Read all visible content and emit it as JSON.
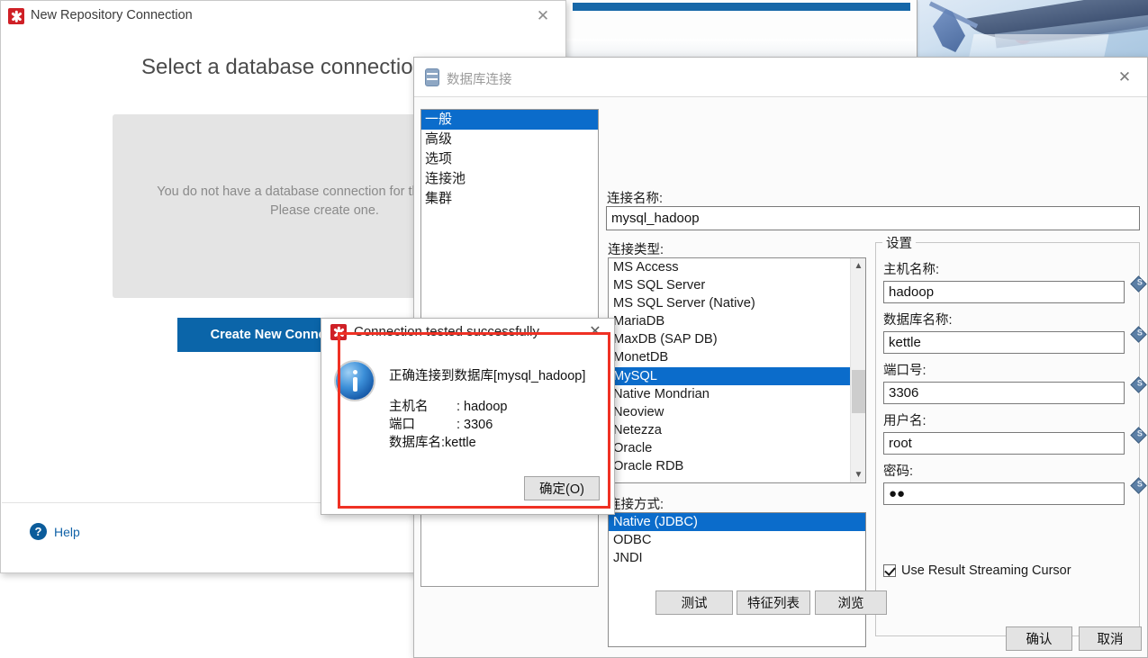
{
  "repo_window": {
    "title": "New Repository Connection",
    "icon": "kettle-logo-icon",
    "close_label": "✕",
    "heading": "Select a database connection",
    "empty_message": "You do not have a database connection for this repository. Please create one.",
    "create_button": "Create New Connection",
    "help_label": "Help",
    "help_icon": "question-mark-icon"
  },
  "db_window": {
    "title": "数据库连接",
    "icon": "database-icon",
    "close_label": "✕",
    "categories": [
      {
        "label": "一般",
        "selected": true
      },
      {
        "label": "高级",
        "selected": false
      },
      {
        "label": "选项",
        "selected": false
      },
      {
        "label": "连接池",
        "selected": false
      },
      {
        "label": "集群",
        "selected": false
      }
    ],
    "connection_name": {
      "label": "连接名称:",
      "value": "mysql_hadoop"
    },
    "connection_type": {
      "label": "连接类型:",
      "options": [
        {
          "label": "MS Access",
          "selected": false
        },
        {
          "label": "MS SQL Server",
          "selected": false
        },
        {
          "label": "MS SQL Server (Native)",
          "selected": false
        },
        {
          "label": "MariaDB",
          "selected": false
        },
        {
          "label": "MaxDB (SAP DB)",
          "selected": false
        },
        {
          "label": "MonetDB",
          "selected": false
        },
        {
          "label": "MySQL",
          "selected": true
        },
        {
          "label": "Native Mondrian",
          "selected": false
        },
        {
          "label": "Neoview",
          "selected": false
        },
        {
          "label": "Netezza",
          "selected": false
        },
        {
          "label": "Oracle",
          "selected": false
        },
        {
          "label": "Oracle RDB",
          "selected": false
        }
      ],
      "scroll_up_icon": "chevron-up-icon",
      "scroll_down_icon": "chevron-down-icon"
    },
    "access_method": {
      "label": "连接方式:",
      "options": [
        {
          "label": "Native (JDBC)",
          "selected": true
        },
        {
          "label": "ODBC",
          "selected": false
        },
        {
          "label": "JNDI",
          "selected": false
        }
      ]
    },
    "settings": {
      "legend": "设置",
      "fields": [
        {
          "label": "主机名称:",
          "value": "hadoop",
          "name": "hostname"
        },
        {
          "label": "数据库名称:",
          "value": "kettle",
          "name": "database-name"
        },
        {
          "label": "端口号:",
          "value": "3306",
          "name": "port"
        },
        {
          "label": "用户名:",
          "value": "root",
          "name": "username"
        },
        {
          "label": "密码:",
          "value": "●●",
          "name": "password"
        }
      ],
      "streaming_cursor": {
        "label": "Use Result Streaming Cursor",
        "checked": true
      }
    },
    "buttons": {
      "test": "测试",
      "feature_list": "特征列表",
      "browse": "浏览",
      "ok": "确认",
      "cancel": "取消"
    }
  },
  "message_dialog": {
    "title": "Connection tested successfully",
    "icon": "kettle-logo-icon",
    "info_icon": "info-icon",
    "close_label": "✕",
    "line1": "正确连接到数据库[mysql_hadoop]",
    "rows": [
      {
        "key": "主机名",
        "value": ": hadoop"
      },
      {
        "key": "端口",
        "value": ": 3306"
      },
      {
        "key": "数据库名:kettle",
        "value": ""
      }
    ],
    "ok_button": "确定(O)",
    "highlight_color": "#ef3124"
  },
  "colors": {
    "selection_blue": "#0b6ccb",
    "primary_button": "#0b65a9",
    "kettle_red": "#cf2026",
    "link_blue": "#1263a8"
  }
}
